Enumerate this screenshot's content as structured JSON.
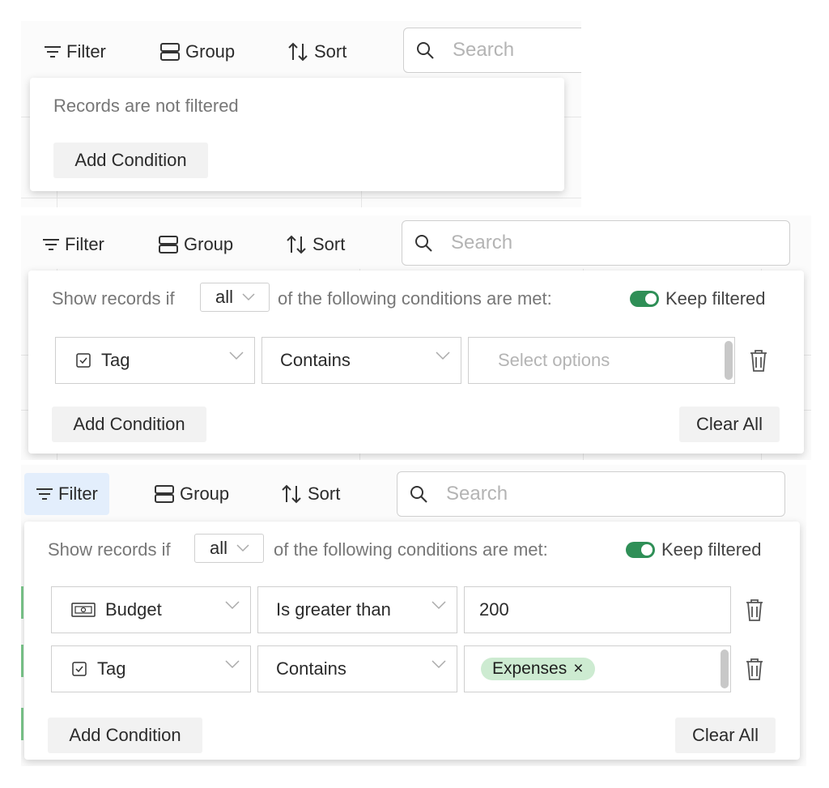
{
  "toolbar": {
    "filter_label": "Filter",
    "group_label": "Group",
    "sort_label": "Sort",
    "search_placeholder": "Search"
  },
  "panel1": {
    "empty_text": "Records are not filtered",
    "add_condition": "Add Condition"
  },
  "panel2": {
    "show_prefix": "Show records if",
    "match_mode": "all",
    "show_suffix": "of the following conditions are met:",
    "keep_filtered": "Keep filtered",
    "conditions": [
      {
        "field": "Tag",
        "field_icon": "checkbox-icon",
        "operator": "Contains",
        "value_placeholder": "Select options"
      }
    ],
    "add_condition": "Add Condition",
    "clear_all": "Clear All"
  },
  "panel3": {
    "show_prefix": "Show records if",
    "match_mode": "all",
    "show_suffix": "of the following conditions are met:",
    "keep_filtered": "Keep filtered",
    "conditions": [
      {
        "field": "Budget",
        "field_icon": "currency-icon",
        "operator": "Is greater than",
        "value": "200"
      },
      {
        "field": "Tag",
        "field_icon": "checkbox-icon",
        "operator": "Contains",
        "chip": "Expenses",
        "chip_remove": "×"
      }
    ],
    "add_condition": "Add Condition",
    "clear_all": "Clear All"
  },
  "colors": {
    "toggle_on": "#2f8f57",
    "chip_bg": "#cdebd1",
    "filter_active_bg": "#e3eefc"
  }
}
